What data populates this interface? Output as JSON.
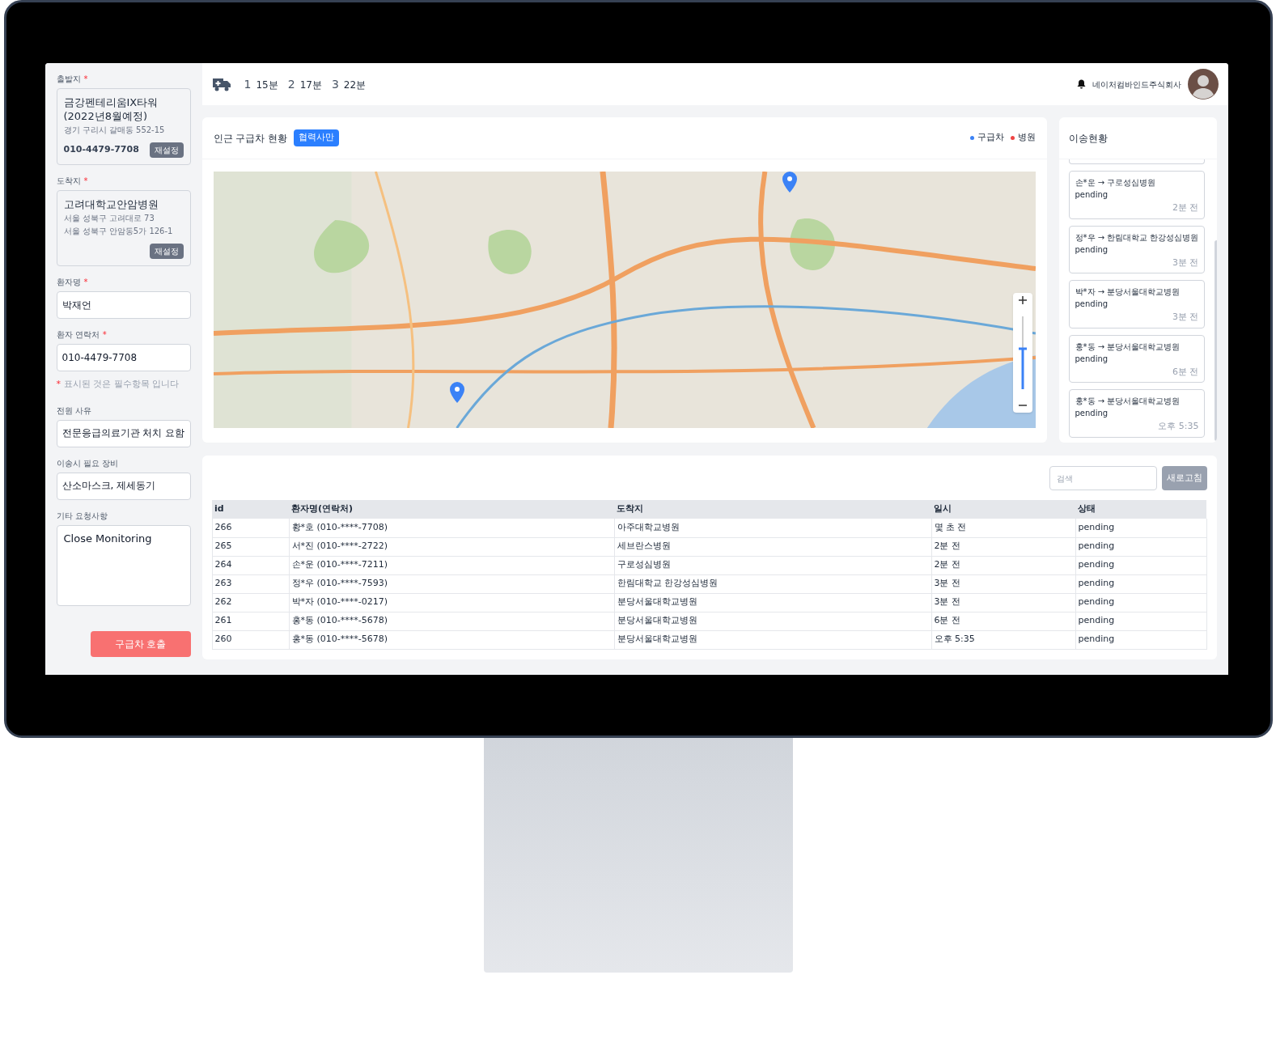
{
  "sidebar": {
    "origin": {
      "label": "출발지",
      "required": true,
      "name": "금강펜테리움IX타워 (2022년8월예정)",
      "addresses": [
        "경기 구리시 갈매동 552-15"
      ],
      "phone": "010-4479-7708",
      "button": "재설정"
    },
    "destination": {
      "label": "도착지",
      "required": true,
      "name": "고려대학교안암병원",
      "addresses": [
        "서울 성북구 고려대로 73",
        "서울 성북구 안암동5가 126-1"
      ],
      "button": "재설정"
    },
    "fields_top": [
      {
        "label": "환자명",
        "required": true,
        "value": "박재언"
      },
      {
        "label": "환자 연락처",
        "required": true,
        "value": "010-4479-7708"
      }
    ],
    "note": {
      "mark": "*",
      "text": "표시된 것은 필수항목 입니다"
    },
    "fields_bottom": [
      {
        "label": "전원 사유",
        "required": false,
        "value": "전문응급의료기관 처치 요함"
      },
      {
        "label": "이송시 필요 장비",
        "required": false,
        "value": "산소마스크, 제세동기"
      }
    ],
    "request": {
      "label": "기타 요청사항",
      "value": "Close Monitoring"
    },
    "submit": "구급차 호출"
  },
  "topbar": {
    "etas": [
      {
        "rank": "1",
        "time": "15분"
      },
      {
        "rank": "2",
        "time": "17분"
      },
      {
        "rank": "3",
        "time": "22분"
      }
    ],
    "company": "네이처컴바인드주식회사"
  },
  "map_panel": {
    "title": "인근 구급차 현황",
    "badge": "협력사만",
    "legend": [
      {
        "label": "구급차",
        "color": "#3b82f6"
      },
      {
        "label": "병원",
        "color": "#ef4444"
      }
    ]
  },
  "transfers": {
    "title": "이송현황",
    "items": [
      {
        "route": "손*운 → 구로성심병원",
        "status": "pending",
        "time": "2분 전"
      },
      {
        "route": "정*우 → 한림대학교 한강성심병원",
        "status": "pending",
        "time": "3분 전"
      },
      {
        "route": "박*자 → 분당서울대학교병원",
        "status": "pending",
        "time": "3분 전"
      },
      {
        "route": "홍*동 → 분당서울대학교병원",
        "status": "pending",
        "time": "6분 전"
      },
      {
        "route": "홍*동 → 분당서울대학교병원",
        "status": "pending",
        "time": "오후 5:35"
      }
    ]
  },
  "table": {
    "search": {
      "placeholder": "검색"
    },
    "refresh": "새로고침",
    "columns": [
      "id",
      "환자명(연락처)",
      "도착지",
      "일시",
      "상태"
    ],
    "rows": [
      [
        "266",
        "황*호 (010-****-7708)",
        "아주대학교병원",
        "몇 초 전",
        "pending"
      ],
      [
        "265",
        "서*진 (010-****-2722)",
        "세브란스병원",
        "2분 전",
        "pending"
      ],
      [
        "264",
        "손*운 (010-****-7211)",
        "구로성심병원",
        "2분 전",
        "pending"
      ],
      [
        "263",
        "정*우 (010-****-7593)",
        "한림대학교 한강성심병원",
        "3분 전",
        "pending"
      ],
      [
        "262",
        "박*자 (010-****-0217)",
        "분당서울대학교병원",
        "3분 전",
        "pending"
      ],
      [
        "261",
        "홍*동 (010-****-5678)",
        "분당서울대학교병원",
        "6분 전",
        "pending"
      ],
      [
        "260",
        "홍*동 (010-****-5678)",
        "분당서울대학교병원",
        "오후 5:35",
        "pending"
      ]
    ]
  }
}
